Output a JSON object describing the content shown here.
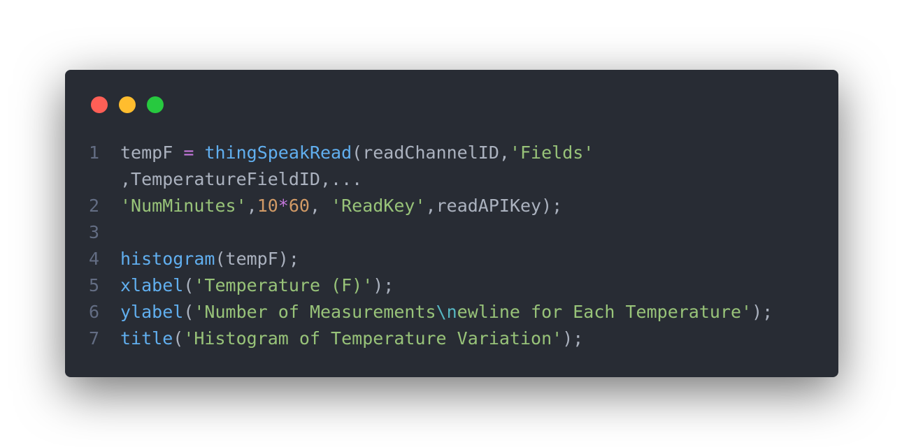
{
  "window": {
    "controls": [
      {
        "name": "close",
        "color": "#ff5f56"
      },
      {
        "name": "minimize",
        "color": "#ffbd2e"
      },
      {
        "name": "maximize",
        "color": "#27c93f"
      }
    ]
  },
  "colors": {
    "background": "#282c34",
    "text": "#abb2bf",
    "line_number": "#636d83",
    "operator": "#c678dd",
    "function": "#61afef",
    "string": "#98c379",
    "number": "#d19a66",
    "escape": "#56b6c2"
  },
  "code": {
    "lines": [
      {
        "number": "1",
        "tokens": [
          {
            "text": "tempF ",
            "type": "plain"
          },
          {
            "text": "=",
            "type": "op"
          },
          {
            "text": " ",
            "type": "plain"
          },
          {
            "text": "thingSpeakRead",
            "type": "fn"
          },
          {
            "text": "(readChannelID,",
            "type": "plain"
          },
          {
            "text": "'Fields'",
            "type": "str"
          }
        ]
      },
      {
        "number": "",
        "tokens": [
          {
            "text": ",TemperatureFieldID,...",
            "type": "plain"
          }
        ]
      },
      {
        "number": "2",
        "tokens": [
          {
            "text": "'NumMinutes'",
            "type": "str"
          },
          {
            "text": ",",
            "type": "plain"
          },
          {
            "text": "10",
            "type": "num"
          },
          {
            "text": "*",
            "type": "op"
          },
          {
            "text": "60",
            "type": "num"
          },
          {
            "text": ", ",
            "type": "plain"
          },
          {
            "text": "'ReadKey'",
            "type": "str"
          },
          {
            "text": ",readAPIKey);",
            "type": "plain"
          }
        ]
      },
      {
        "number": "3",
        "tokens": []
      },
      {
        "number": "4",
        "tokens": [
          {
            "text": "histogram",
            "type": "fn"
          },
          {
            "text": "(tempF);",
            "type": "plain"
          }
        ]
      },
      {
        "number": "5",
        "tokens": [
          {
            "text": "xlabel",
            "type": "fn"
          },
          {
            "text": "(",
            "type": "plain"
          },
          {
            "text": "'Temperature (F)'",
            "type": "str"
          },
          {
            "text": ");",
            "type": "plain"
          }
        ]
      },
      {
        "number": "6",
        "tokens": [
          {
            "text": "ylabel",
            "type": "fn"
          },
          {
            "text": "(",
            "type": "plain"
          },
          {
            "text": "'Number of Measurements",
            "type": "str"
          },
          {
            "text": "\\n",
            "type": "esc"
          },
          {
            "text": "ewline for Each Temperature'",
            "type": "str"
          },
          {
            "text": ");",
            "type": "plain"
          }
        ]
      },
      {
        "number": "7",
        "tokens": [
          {
            "text": "title",
            "type": "fn"
          },
          {
            "text": "(",
            "type": "plain"
          },
          {
            "text": "'Histogram of Temperature Variation'",
            "type": "str"
          },
          {
            "text": ");",
            "type": "plain"
          }
        ]
      }
    ]
  }
}
